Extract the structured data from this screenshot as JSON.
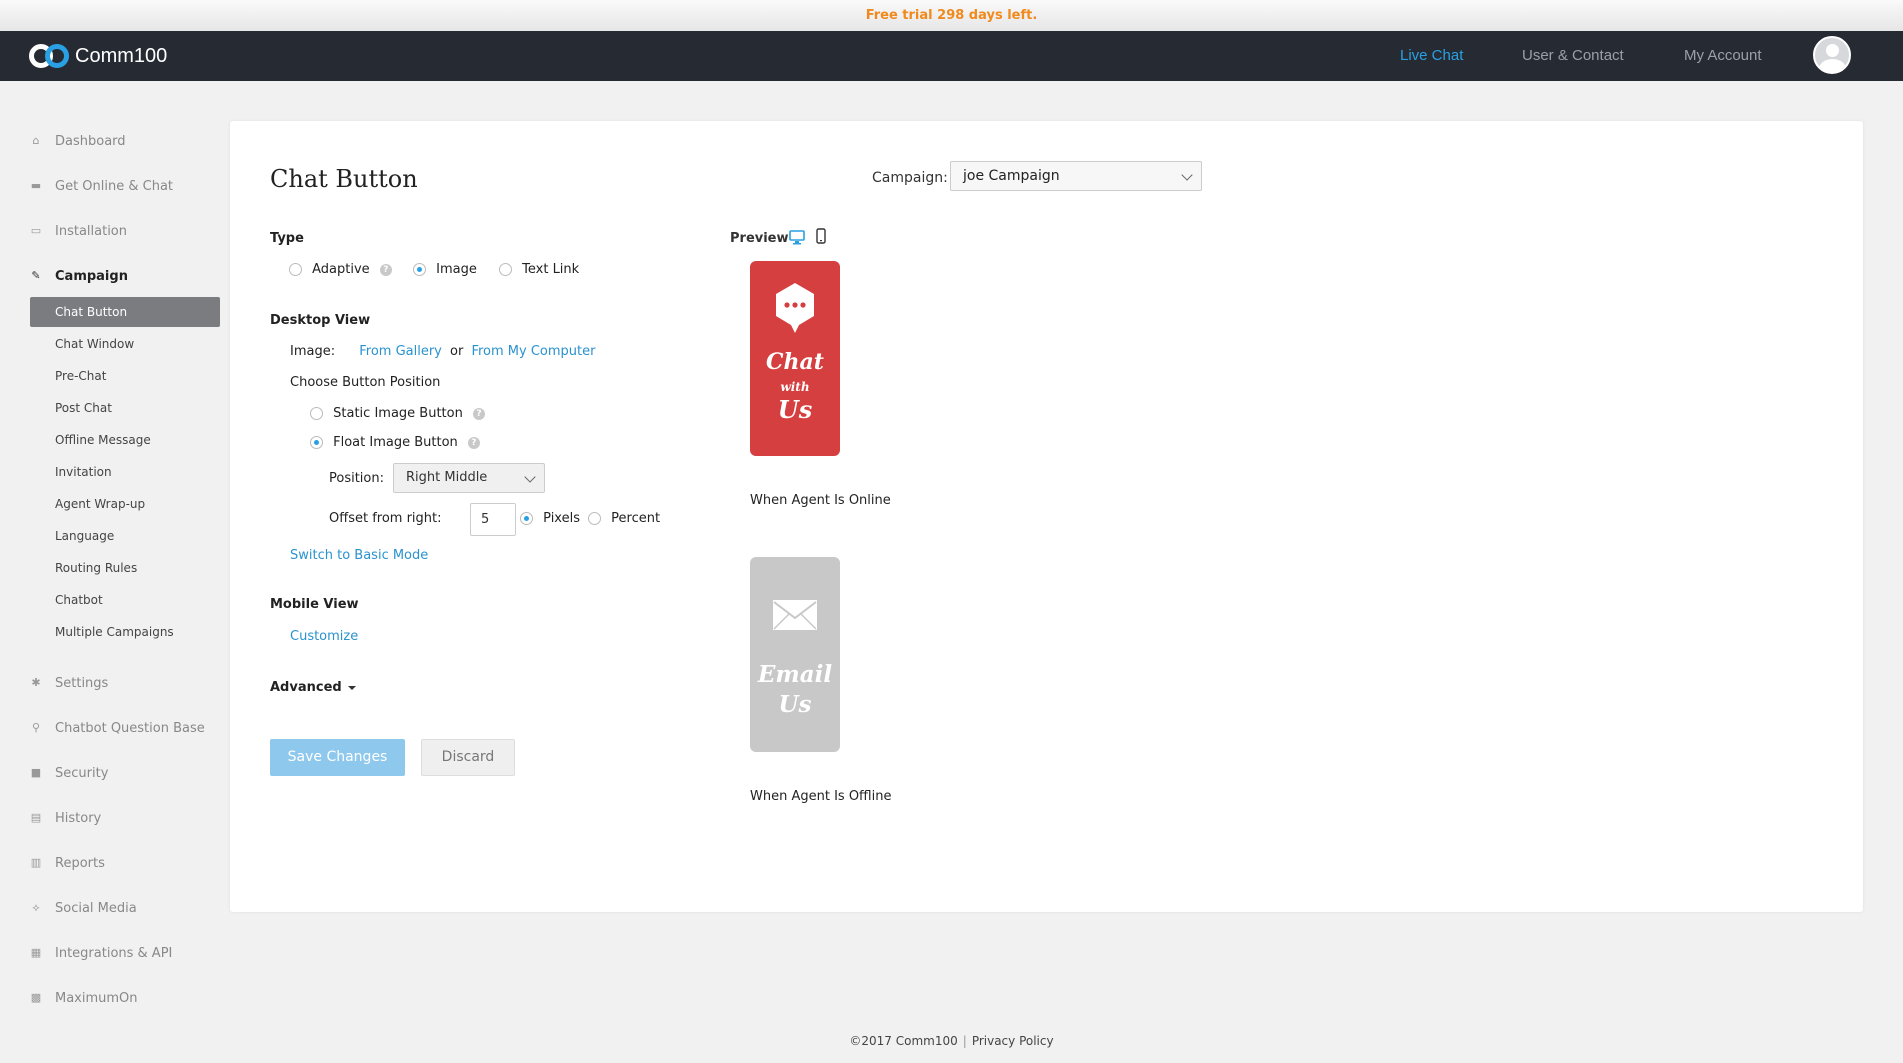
{
  "trial_banner": "Free trial 298 days left.",
  "brand": {
    "name": "Comm100",
    "accent": "#2aa0e4"
  },
  "topnav": {
    "live_chat": "Live Chat",
    "user_contact": "User & Contact",
    "my_account": "My Account"
  },
  "sidebar": {
    "items": [
      {
        "label": "Dashboard",
        "icon": "home-icon"
      },
      {
        "label": "Get Online & Chat",
        "icon": "chat-icon"
      },
      {
        "label": "Installation",
        "icon": "installation-icon"
      },
      {
        "label": "Campaign",
        "icon": "edit-icon"
      },
      {
        "label": "Settings",
        "icon": "gear-icon"
      },
      {
        "label": "Chatbot Question Base",
        "icon": "bot-icon"
      },
      {
        "label": "Security",
        "icon": "lock-icon"
      },
      {
        "label": "History",
        "icon": "history-icon"
      },
      {
        "label": "Reports",
        "icon": "bar-chart-icon"
      },
      {
        "label": "Social Media",
        "icon": "share-icon"
      },
      {
        "label": "Integrations & API",
        "icon": "plug-icon"
      },
      {
        "label": "MaximumOn",
        "icon": "grid-icon"
      }
    ],
    "campaign_sub": [
      "Chat Button",
      "Chat Window",
      "Pre-Chat",
      "Post Chat",
      "Offline Message",
      "Invitation",
      "Agent Wrap-up",
      "Language",
      "Routing Rules",
      "Chatbot",
      "Multiple Campaigns"
    ]
  },
  "main": {
    "title": "Chat Button",
    "campaign_label": "Campaign:",
    "campaign_value": "joe Campaign",
    "type": {
      "label": "Type",
      "options": [
        "Adaptive",
        "Image",
        "Text Link"
      ],
      "selected": "Image"
    },
    "desktop": {
      "label": "Desktop View",
      "image_label": "Image:",
      "from_gallery": "From Gallery",
      "or": "or",
      "from_computer": "From My Computer",
      "choose_position": "Choose Button Position",
      "static_image": "Static Image Button",
      "float_image": "Float Image Button",
      "position_label": "Position:",
      "position_value": "Right Middle",
      "offset_label": "Offset from right:",
      "offset_value": "5",
      "pixels": "Pixels",
      "percent": "Percent",
      "switch_mode": "Switch to Basic Mode"
    },
    "mobile": {
      "label": "Mobile View",
      "customize": "Customize"
    },
    "advanced": "Advanced",
    "save": "Save Changes",
    "discard": "Discard"
  },
  "preview": {
    "label": "Preview",
    "online_image": {
      "line1": "Chat",
      "line2": "with",
      "line3": "Us",
      "color": "#d63f3f"
    },
    "online_caption": "When Agent Is Online",
    "offline_image": {
      "line1": "Email",
      "line2": "Us",
      "color": "#c8c8c8"
    },
    "offline_caption": "When Agent Is Offline"
  },
  "footer": {
    "copyright": "©2017 Comm100",
    "privacy": "Privacy Policy"
  }
}
